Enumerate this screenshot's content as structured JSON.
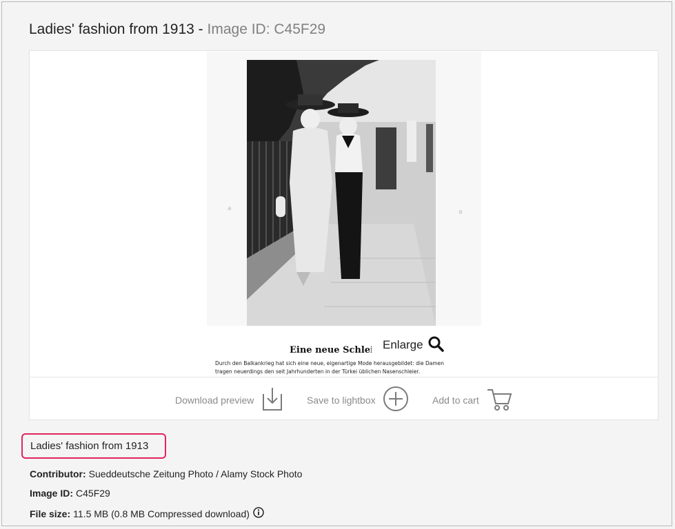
{
  "header": {
    "title": "Ladies' fashion from 1913",
    "separator": " - ",
    "image_id_text": "Image ID: C45F29"
  },
  "photo": {
    "headline": "Eine neue Schleiermode.",
    "caption_line1": "Durch den Balkankrieg hat sich eine neue, eigenartige Mode herausgebildet: die Damen",
    "caption_line2": "tragen neuerdings den seit Jahrhunderten in der Türkei üblichen Nasenschleier."
  },
  "enlarge": {
    "label": "Enlarge",
    "icon": "search-icon"
  },
  "actions": {
    "download_label": "Download preview",
    "download_icon": "download-icon",
    "lightbox_label": "Save to lightbox",
    "lightbox_icon": "plus-circle-icon",
    "cart_label": "Add to cart",
    "cart_icon": "cart-icon"
  },
  "details": {
    "caption": "Ladies' fashion from 1913",
    "contributor_label": "Contributor:",
    "contributor_value": "Sueddeutsche Zeitung Photo / Alamy Stock Photo",
    "image_id_label": "Image ID:",
    "image_id_value": "C45F29",
    "file_size_label": "File size:",
    "file_size_value": "11.5 MB (0.8 MB Compressed download)",
    "info_icon": "info-icon"
  },
  "colors": {
    "highlight_border": "#e0245e",
    "muted_text": "#8a8a8a",
    "id_gray": "#808080"
  }
}
